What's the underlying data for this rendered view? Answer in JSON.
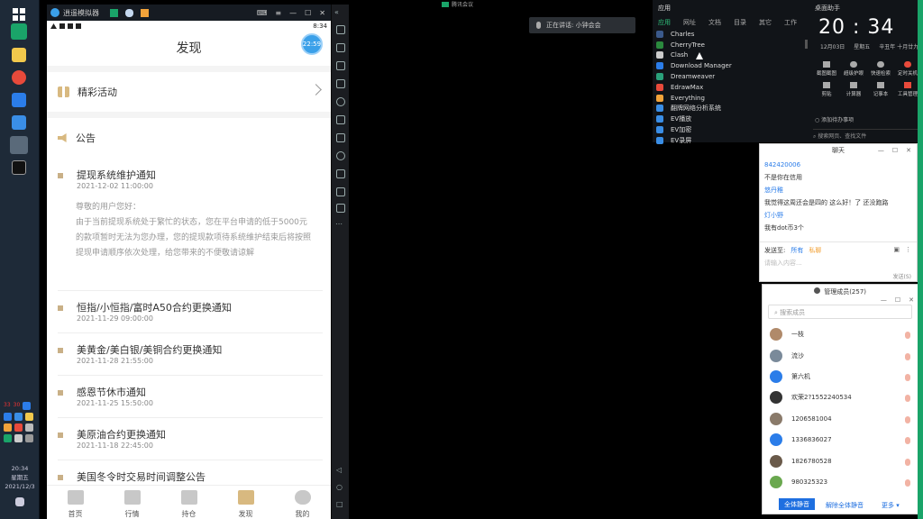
{
  "taskbar": {
    "time": "20:34",
    "weekday": "星期五",
    "date": "2021/12/3",
    "tray_nums": [
      "33",
      "30"
    ]
  },
  "emulator": {
    "title": "逍遥模拟器",
    "android_time": "8:34",
    "bubble": "22:59"
  },
  "app": {
    "title": "发现",
    "promo_label": "精彩活动",
    "notice_label": "公告",
    "notices": [
      {
        "title": "提现系统维护通知",
        "date": "2021-12-02 11:00:00"
      },
      {
        "title": "恒指/小恒指/富时A50合约更换通知",
        "date": "2021-11-29 09:00:00"
      },
      {
        "title": "美黄金/美白银/美铜合约更换通知",
        "date": "2021-11-28 21:55:00"
      },
      {
        "title": "感恩节休市通知",
        "date": "2021-11-25 15:50:00"
      },
      {
        "title": "美原油合约更换通知",
        "date": "2021-11-18 22:45:00"
      },
      {
        "title": "美国冬令时交易时间调整公告",
        "date": ""
      }
    ],
    "body": [
      "尊敬的用户您好：",
      "由于当前提现系统处于繁忙的状态，您在平台申请的低于5000元的款项暂时无法为您办理，您的提现款项待系统维护结束后将按照提现申请顺序依次处理，给您带来的不便敬请谅解"
    ],
    "nav": [
      "首页",
      "行情",
      "持仓",
      "发现",
      "我的"
    ]
  },
  "meeting": {
    "label": "腾讯会议"
  },
  "asr": {
    "text": "正在讲话: 小钟会会"
  },
  "launcher": {
    "title": "应用",
    "tabs": [
      "应用",
      "网址",
      "文档",
      "目录",
      "其它",
      "工作"
    ],
    "apps": [
      "Charles",
      "CherryTree",
      "Clash",
      "Download Manager",
      "Dreamweaver",
      "EdrawMax",
      "Everything",
      "翻牌网络分析系统",
      "EV播放",
      "EV加密",
      "EV录屏"
    ]
  },
  "assistant": {
    "title": "桌面助手",
    "clock": "20 : 34",
    "date": "12月03日",
    "weekday": "星期五",
    "lunar": "辛丑年 十月廿九",
    "tools": [
      "截图截图",
      "超级护眼",
      "快速检索",
      "定时关机",
      "剪贴",
      "计算器",
      "记事本",
      "工具管理"
    ],
    "todo": "添加待办事项",
    "search": "搜索网页、查找文件"
  },
  "chat": {
    "title": "聊天",
    "msgs": [
      {
        "who": "842420006",
        "text": "不是你在信用"
      },
      {
        "who": "悠丹稚",
        "text": "我觉得这周还会是四的 这么好！了 还没跑路"
      },
      {
        "who": "灯小野",
        "text": "我有dot币3个"
      }
    ],
    "input_label": "发送至:",
    "to": "所有",
    "tag": "私聊",
    "placeholder": "请输入内容...",
    "send": "发送(S)"
  },
  "members": {
    "title": "管理成员(257)",
    "search": "搜索成员",
    "list": [
      "一枝",
      "流沙",
      "第六机",
      "欢荣2?1552240534",
      "1206581004",
      "1336836027",
      "1826780528",
      "980325323"
    ],
    "btn_mute": "全体静音",
    "btn_unmute": "解除全体静音",
    "btn_more": "更多"
  }
}
